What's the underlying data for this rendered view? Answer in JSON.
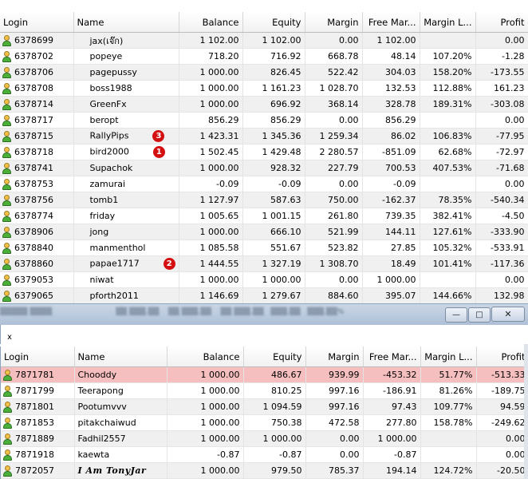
{
  "top_table": {
    "headers": [
      "Login",
      "Name",
      "Balance",
      "Equity",
      "Margin",
      "Free Mar...",
      "Margin L...",
      "Profit"
    ],
    "rows": [
      {
        "login": "6378699",
        "name": "jax(เจ๊ก)",
        "balance": "1 102.00",
        "equity": "1 102.00",
        "margin": "0.00",
        "free_margin": "1 102.00",
        "margin_level": "",
        "profit": "0.00",
        "badge": ""
      },
      {
        "login": "6378702",
        "name": "popeye",
        "balance": "718.20",
        "equity": "716.92",
        "margin": "668.78",
        "free_margin": "48.14",
        "margin_level": "107.20%",
        "profit": "-1.28",
        "badge": ""
      },
      {
        "login": "6378706",
        "name": "pagepussy",
        "balance": "1 000.00",
        "equity": "826.45",
        "margin": "522.42",
        "free_margin": "304.03",
        "margin_level": "158.20%",
        "profit": "-173.55",
        "badge": ""
      },
      {
        "login": "6378708",
        "name": "boss1988",
        "balance": "1 000.00",
        "equity": "1 161.23",
        "margin": "1 028.70",
        "free_margin": "132.53",
        "margin_level": "112.88%",
        "profit": "161.23",
        "badge": ""
      },
      {
        "login": "6378714",
        "name": "GreenFx",
        "balance": "1 000.00",
        "equity": "696.92",
        "margin": "368.14",
        "free_margin": "328.78",
        "margin_level": "189.31%",
        "profit": "-303.08",
        "badge": ""
      },
      {
        "login": "6378717",
        "name": "beropt",
        "balance": "856.29",
        "equity": "856.29",
        "margin": "0.00",
        "free_margin": "856.29",
        "margin_level": "",
        "profit": "0.00",
        "badge": ""
      },
      {
        "login": "6378715",
        "name": "RallyPips",
        "balance": "1 423.31",
        "equity": "1 345.36",
        "margin": "1 259.34",
        "free_margin": "86.02",
        "margin_level": "106.83%",
        "profit": "-77.95",
        "badge": "3"
      },
      {
        "login": "6378718",
        "name": "bird2000",
        "balance": "1 502.45",
        "equity": "1 429.48",
        "margin": "2 280.57",
        "free_margin": "-851.09",
        "margin_level": "62.68%",
        "profit": "-72.97",
        "badge": "1"
      },
      {
        "login": "6378741",
        "name": "Supachok",
        "balance": "1 000.00",
        "equity": "928.32",
        "margin": "227.79",
        "free_margin": "700.53",
        "margin_level": "407.53%",
        "profit": "-71.68",
        "badge": ""
      },
      {
        "login": "6378753",
        "name": "zamurai",
        "balance": "-0.09",
        "equity": "-0.09",
        "margin": "0.00",
        "free_margin": "-0.09",
        "margin_level": "",
        "profit": "0.00",
        "badge": ""
      },
      {
        "login": "6378756",
        "name": "tomb1",
        "balance": "1 127.97",
        "equity": "587.63",
        "margin": "750.00",
        "free_margin": "-162.37",
        "margin_level": "78.35%",
        "profit": "-540.34",
        "badge": ""
      },
      {
        "login": "6378774",
        "name": "friday",
        "balance": "1 005.65",
        "equity": "1 001.15",
        "margin": "261.80",
        "free_margin": "739.35",
        "margin_level": "382.41%",
        "profit": "-4.50",
        "badge": ""
      },
      {
        "login": "6378906",
        "name": "jong",
        "balance": "1 000.00",
        "equity": "666.10",
        "margin": "521.99",
        "free_margin": "144.11",
        "margin_level": "127.61%",
        "profit": "-333.90",
        "badge": ""
      },
      {
        "login": "6378840",
        "name": "manmenthol",
        "balance": "1 085.58",
        "equity": "551.67",
        "margin": "523.82",
        "free_margin": "27.85",
        "margin_level": "105.32%",
        "profit": "-533.91",
        "badge": ""
      },
      {
        "login": "6378860",
        "name": "papae1717",
        "balance": "1 444.55",
        "equity": "1 327.19",
        "margin": "1 308.70",
        "free_margin": "18.49",
        "margin_level": "101.41%",
        "profit": "-117.36",
        "badge": "2"
      },
      {
        "login": "6379053",
        "name": "niwat",
        "balance": "1 000.00",
        "equity": "1 000.00",
        "margin": "0.00",
        "free_margin": "1 000.00",
        "margin_level": "",
        "profit": "0.00",
        "badge": ""
      },
      {
        "login": "6379065",
        "name": "pforth2011",
        "balance": "1 146.69",
        "equity": "1 279.67",
        "margin": "884.60",
        "free_margin": "395.07",
        "margin_level": "144.66%",
        "profit": "132.98",
        "badge": ""
      }
    ]
  },
  "window_controls": {
    "minimize": "—",
    "maximize": "□",
    "close": "✕"
  },
  "bottom_close": "x",
  "bottom_table": {
    "headers": [
      "Login",
      "Name",
      "Balance",
      "Equity",
      "Margin",
      "Free Mar...",
      "Margin L...",
      "Profit"
    ],
    "rows": [
      {
        "login": "7871781",
        "name": "Chooddy",
        "balance": "1 000.00",
        "equity": "486.67",
        "margin": "939.99",
        "free_margin": "-453.32",
        "margin_level": "51.77%",
        "profit": "-513.33",
        "highlight": true
      },
      {
        "login": "7871799",
        "name": "Teerapong",
        "balance": "1 000.00",
        "equity": "810.25",
        "margin": "997.16",
        "free_margin": "-186.91",
        "margin_level": "81.26%",
        "profit": "-189.75"
      },
      {
        "login": "7871801",
        "name": "Pootumvvv",
        "balance": "1 000.00",
        "equity": "1 094.59",
        "margin": "997.16",
        "free_margin": "97.43",
        "margin_level": "109.77%",
        "profit": "94.59"
      },
      {
        "login": "7871853",
        "name": "pitakchaiwud",
        "balance": "1 000.00",
        "equity": "750.38",
        "margin": "472.58",
        "free_margin": "277.80",
        "margin_level": "158.78%",
        "profit": "-249.62"
      },
      {
        "login": "7871889",
        "name": "Fadhil2557",
        "balance": "1 000.00",
        "equity": "1 000.00",
        "margin": "0.00",
        "free_margin": "1 000.00",
        "margin_level": "",
        "profit": "0.00"
      },
      {
        "login": "7871918",
        "name": "kaewta",
        "balance": "-0.87",
        "equity": "-0.87",
        "margin": "0.00",
        "free_margin": "-0.87",
        "margin_level": "",
        "profit": "0.00"
      },
      {
        "login": "7872057",
        "name": "I Am TonyJar",
        "balance": "1 000.00",
        "equity": "979.50",
        "margin": "785.37",
        "free_margin": "194.14",
        "margin_level": "124.72%",
        "profit": "-20.50"
      }
    ]
  }
}
